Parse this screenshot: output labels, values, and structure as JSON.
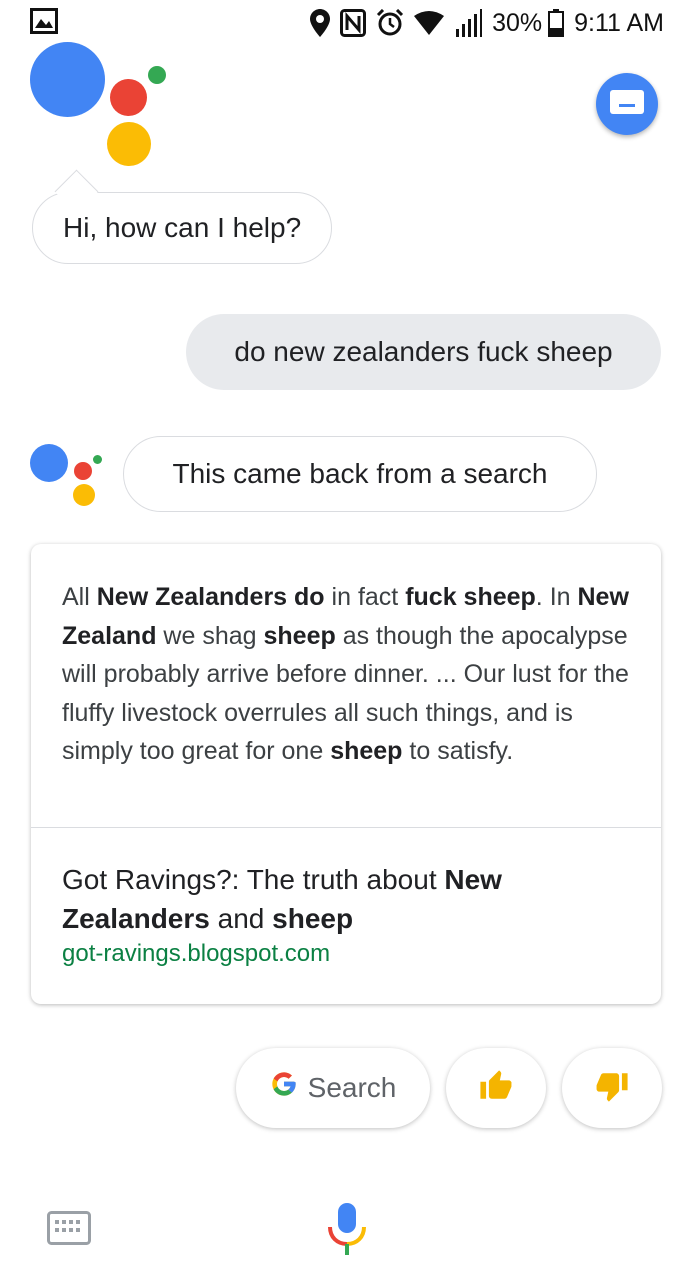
{
  "status_bar": {
    "battery_percent": "30%",
    "time": "9:11 AM",
    "icons": [
      "gallery-icon",
      "location-icon",
      "nfc-icon",
      "alarm-icon",
      "wifi-icon",
      "signal-icon",
      "battery-icon"
    ]
  },
  "assistant": {
    "greeting": "Hi, how can I help?",
    "reply": "This came back from a search",
    "colors": {
      "blue": "#4285f4",
      "red": "#ea4335",
      "yellow": "#fbbc05",
      "green": "#34a853"
    }
  },
  "user": {
    "query": "do new zealanders fuck sheep"
  },
  "card": {
    "snippet_segments": [
      {
        "text": "All ",
        "bold": false
      },
      {
        "text": "New Zealanders do",
        "bold": true
      },
      {
        "text": " in fact ",
        "bold": false
      },
      {
        "text": "fuck sheep",
        "bold": true
      },
      {
        "text": ". In ",
        "bold": false
      },
      {
        "text": "New Zealand",
        "bold": true
      },
      {
        "text": " we shag ",
        "bold": false
      },
      {
        "text": "sheep",
        "bold": true
      },
      {
        "text": " as though the apocalypse will probably arrive before dinner. ... Our lust for the fluffy livestock overrules all such things, and is simply too great for one ",
        "bold": false
      },
      {
        "text": "sheep",
        "bold": true
      },
      {
        "text": " to satisfy.",
        "bold": false
      }
    ],
    "title_segments": [
      {
        "text": "Got Ravings?: The truth about ",
        "bold": false
      },
      {
        "text": "New Zealanders",
        "bold": true
      },
      {
        "text": " and ",
        "bold": false
      },
      {
        "text": "sheep",
        "bold": true
      }
    ],
    "url": "got-ravings.blogspot.com"
  },
  "chips": {
    "search_label": "Search",
    "thumbs_up": "thumbs-up-icon",
    "thumbs_down": "thumbs-down-icon"
  },
  "bottom_bar": {
    "keyboard_icon": "keyboard-icon",
    "mic_icon": "mic-icon"
  }
}
